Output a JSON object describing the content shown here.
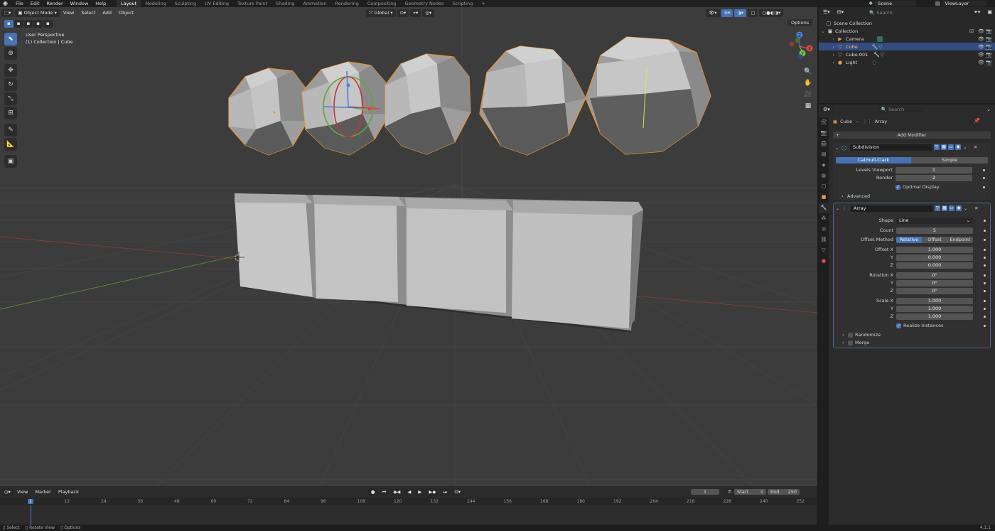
{
  "menus": [
    "File",
    "Edit",
    "Render",
    "Window",
    "Help"
  ],
  "workspaces": [
    "Layout",
    "Modeling",
    "Sculpting",
    "UV Editing",
    "Texture Paint",
    "Shading",
    "Animation",
    "Rendering",
    "Compositing",
    "Geometry Nodes",
    "Scripting"
  ],
  "workspace_add": "+",
  "active_workspace": "Layout",
  "scene": {
    "label": "Scene"
  },
  "view_layer": {
    "label": "ViewLayer"
  },
  "viewport": {
    "mode": "Object Mode",
    "menus": [
      "View",
      "Select",
      "Add",
      "Object"
    ],
    "transform_orientation": "Global",
    "overlay_line1": "User Perspective",
    "overlay_line2": "(1) Collection | Cube",
    "options_label": "Options",
    "gizmo_axes": {
      "x": "X",
      "y": "Y",
      "z": "Z"
    }
  },
  "timeline": {
    "menus": [
      "View",
      "Marker",
      "Playback"
    ],
    "current_frame": "1",
    "start_label": "Start",
    "start": "1",
    "end_label": "End",
    "end": "250",
    "ruler_ticks": [
      "1",
      "12",
      "24",
      "36",
      "48",
      "60",
      "72",
      "84",
      "96",
      "108",
      "120",
      "132",
      "144",
      "156",
      "168",
      "180",
      "192",
      "204",
      "216",
      "228",
      "240",
      "252"
    ]
  },
  "status": {
    "items": [
      "Select",
      "Rotate View",
      "Options"
    ],
    "version": "4.1.1"
  },
  "outliner": {
    "search_placeholder": "Search",
    "root": "Scene Collection",
    "collection": "Collection",
    "items": [
      {
        "name": "Camera",
        "icon": "camera-icon",
        "color": "#e69b55"
      },
      {
        "name": "Cube",
        "icon": "mesh-icon",
        "color": "#e69b55",
        "selected": true
      },
      {
        "name": "Cube.001",
        "icon": "mesh-icon",
        "color": "#e69b55"
      },
      {
        "name": "Light",
        "icon": "light-icon",
        "color": "#e69b55"
      }
    ]
  },
  "properties": {
    "search_placeholder": "Search",
    "breadcrumb_object": "Cube",
    "breadcrumb_modifier": "Array",
    "add_modifier": "Add Modifier",
    "subdivision": {
      "name": "Subdivision",
      "type_catmull": "Catmull-Clark",
      "type_simple": "Simple",
      "levels_viewport_label": "Levels Viewport",
      "levels_viewport": "1",
      "render_label": "Render",
      "render": "2",
      "optimal_display": "Optimal Display",
      "advanced": "Advanced"
    },
    "array": {
      "name": "Array",
      "shape_label": "Shape",
      "shape": "Line",
      "count_label": "Count",
      "count": "5",
      "offset_method_label": "Offset Method",
      "offset_methods": [
        "Relative",
        "Offset",
        "Endpoint"
      ],
      "offset_x_label": "Offset X",
      "offset_x": "1.000",
      "y_label": "Y",
      "z_label": "Z",
      "offset_y": "0.000",
      "offset_z": "0.000",
      "rotation_x_label": "Rotation X",
      "rotation_x": "0°",
      "rotation_y": "0°",
      "rotation_z": "0°",
      "scale_x_label": "Scale X",
      "scale_x": "1.000",
      "scale_y": "1.000",
      "scale_z": "1.000",
      "realize_instances": "Realize Instances",
      "randomize": "Randomize",
      "merge": "Merge"
    }
  },
  "colors": {
    "accent": "#4772b3",
    "selection_outline": "#e8922e",
    "viewport_bg": "#3c3c3c"
  }
}
